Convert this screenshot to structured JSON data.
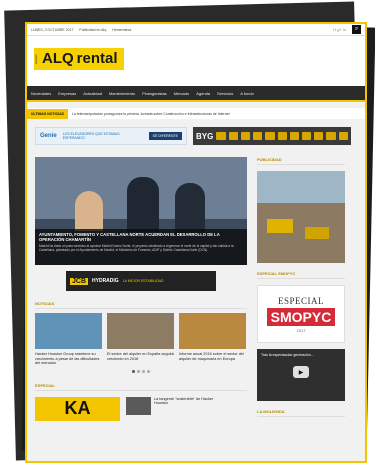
{
  "topbar": {
    "date": "LUNES, 2 OCTUBRE 2017",
    "links": [
      "Publicidad en Alq",
      "Hemeroteca"
    ],
    "social": "f  t  g+  in",
    "search_icon": "search-icon"
  },
  "brand": {
    "tag": "alquiler",
    "name_a": "ALQ",
    "name_b": "rental"
  },
  "nav": {
    "items": [
      "Novedades",
      "Empresas",
      "Actualidad",
      "Mantenimiento",
      "Protagonistas",
      "Mercado",
      "Agenda",
      "Servicios",
      "A fondo"
    ]
  },
  "ticker": {
    "label": "ÚLTIMAS NOTICIAS",
    "text": "La telemanipulación protagoniza la primera Jornada sobre Construcción e Infraestructuras de Internet"
  },
  "banners": {
    "genie_logo": "Genie",
    "genie_text": "LOS ELEVADORES QUE ESTABAS ESPERANDO",
    "genie_button": "SÉ DIFERENTE",
    "byg_logo": "BYG",
    "byg_text": "REPUESTOS PARA MAQUINARIA DE MOVIMIENTO DE TIERRAS"
  },
  "hero": {
    "headline": "AYUNTAMIENTO, FOMENTO Y CASTELLANA NORTE ACUERDAN EL DESARROLLO DE LA OPERACIÓN CHAMARTÍN",
    "summary": "Madrid ha dado un paso decisivo al aprobar Madrid Nuevo Norte, el proyecto destinado a regenerar el norte de la capital y dar cabida a la Castellana, planteado por el Ayuntamiento de Madrid, el Ministerio de Fomento, ADIF y Distrito Castellana Norte (DCN)."
  },
  "jcb": {
    "logo": "JCB",
    "product": "HYDRADIG",
    "slogan": "LA MEJOR ESTABILIDAD"
  },
  "noticias": {
    "title": "NOTICIAS",
    "items": [
      "Hacker Houston Group mantiene su crecimiento a pesar de las dificultades del mercado",
      "El sector del alquiler en España seguirá creciendo en 2018",
      "Informe anual 2016 sobre el sector del alquiler de maquinaria en Europa"
    ]
  },
  "especial": {
    "title": "ESPECIAL",
    "logo": "KA",
    "item": "La tangente \"sostenible\" de Hacker Houston"
  },
  "sidebar": {
    "publicidad_title": "PUBLICIDAD",
    "especial_title": "ESPECIAL SMOPYC",
    "smopyc_top": "ESPECIAL",
    "smopyc_name": "SMOPYC",
    "smopyc_year": "2017",
    "video_title": "Tras la espectacular generación...",
    "play_icon": "play-icon",
    "bottom_title": "LA MOLIENDA"
  }
}
